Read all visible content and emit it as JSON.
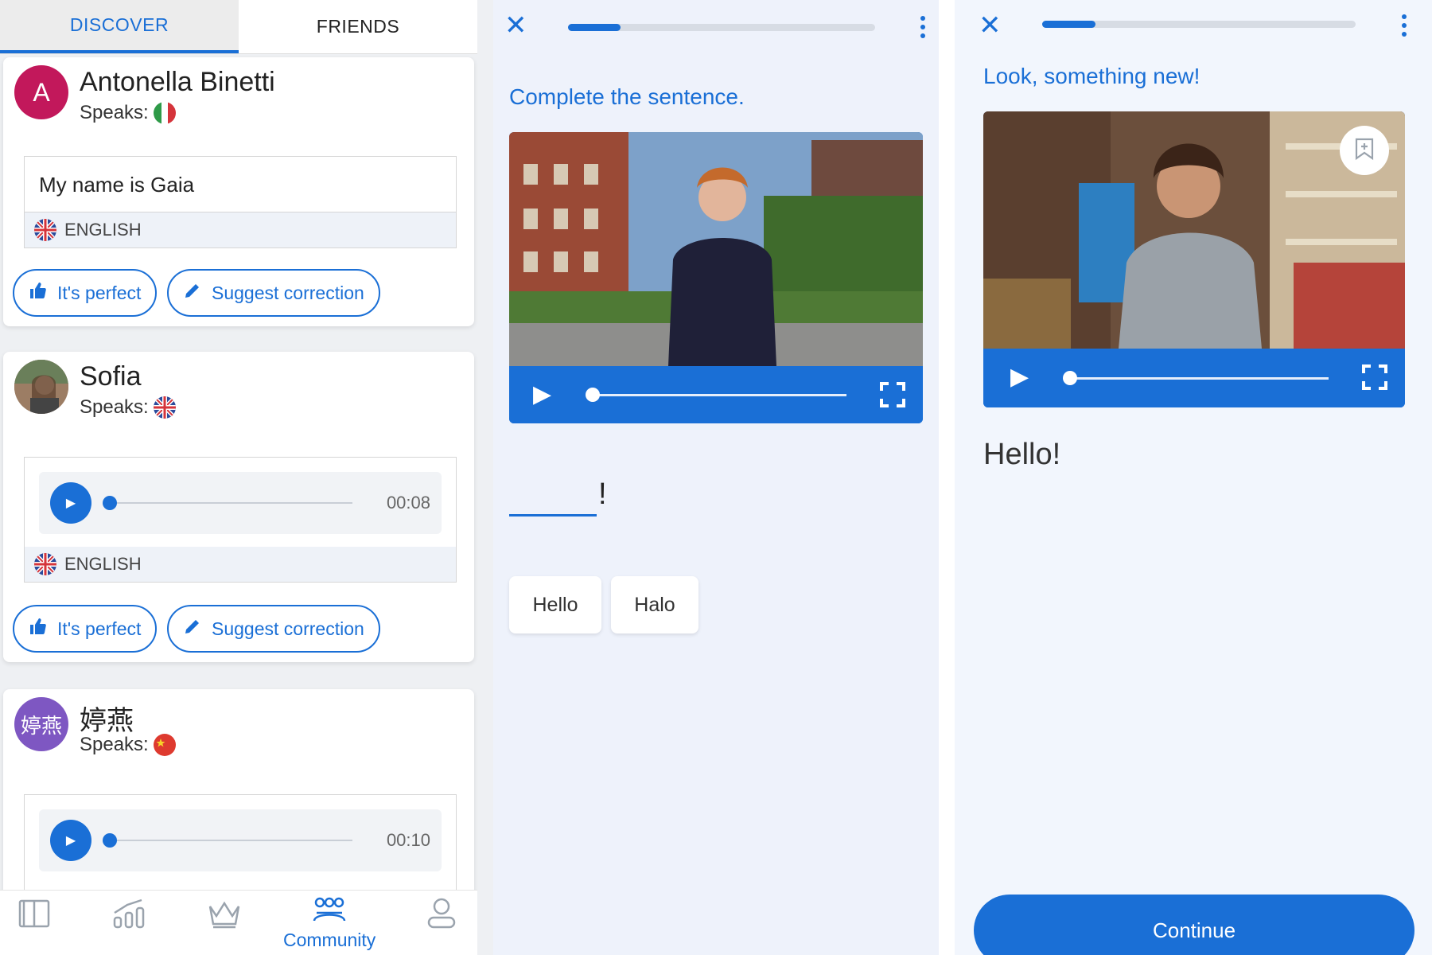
{
  "tabs": {
    "discover": "DISCOVER",
    "friends": "FRIENDS"
  },
  "cards": [
    {
      "avatar_letter": "A",
      "name": "Antonella Binetti",
      "speaks_label": "Speaks:",
      "speaks_flag": "italy-flag",
      "message": "My name is Gaia",
      "language": "ENGLISH",
      "perfect_label": "It's perfect",
      "suggest_label": "Suggest correction"
    },
    {
      "name": "Sofia",
      "speaks_label": "Speaks:",
      "speaks_flag": "uk-flag",
      "audio_time": "00:08",
      "language": "ENGLISH",
      "perfect_label": "It's perfect",
      "suggest_label": "Suggest correction"
    },
    {
      "avatar_letter": "婷燕",
      "name": "婷燕",
      "speaks_label": "Speaks:",
      "speaks_flag": "china-flag",
      "audio_time": "00:10"
    }
  ],
  "bottom_nav": {
    "items": [
      "book-icon",
      "stats-icon",
      "crown-icon",
      "community-icon",
      "profile-icon"
    ],
    "active_label": "Community"
  },
  "exercise": {
    "progress": 0.17,
    "prompt": "Complete the sentence.",
    "blank_suffix": "!",
    "choices": [
      "Hello",
      "Halo"
    ]
  },
  "lesson": {
    "progress": 0.17,
    "prompt": "Look, something new!",
    "phrase": "Hello!",
    "continue_label": "Continue"
  },
  "colors": {
    "accent": "#1a6fd6",
    "avatar_a": "#c2185b",
    "avatar_cn": "#7e57c2"
  }
}
